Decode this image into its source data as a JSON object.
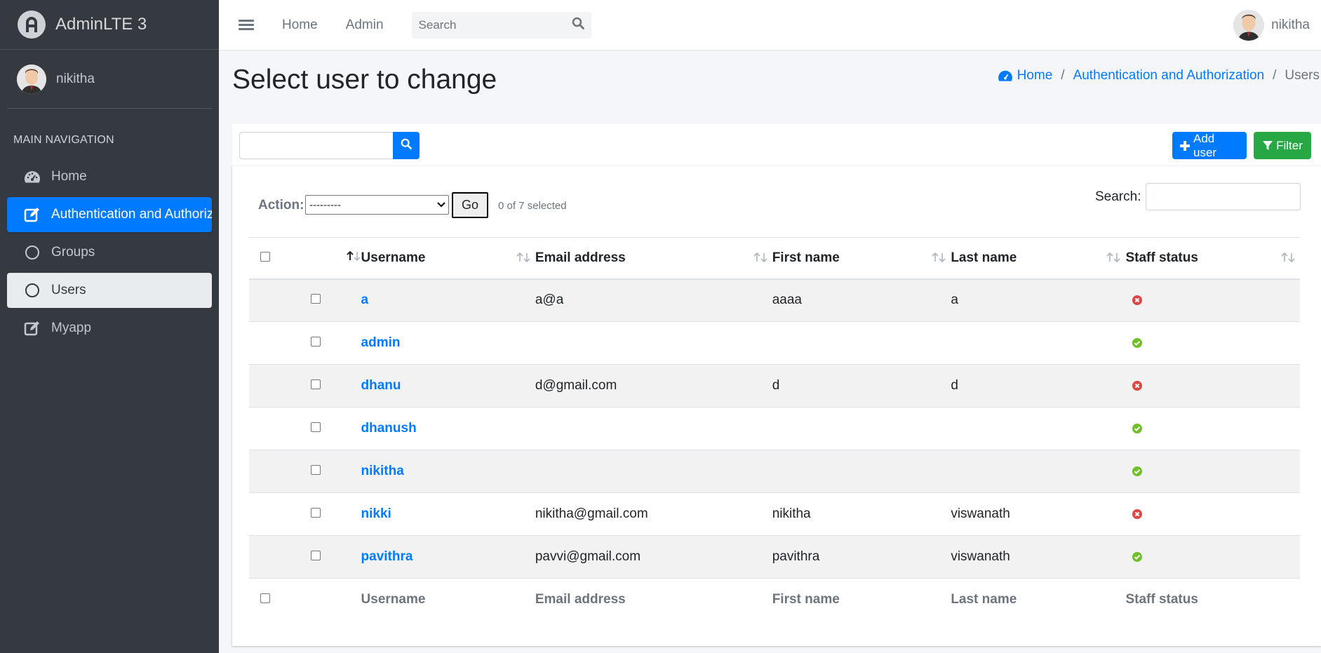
{
  "brand": {
    "name": "AdminLTE 3"
  },
  "sidebar": {
    "user": "nikitha",
    "nav_header": "MAIN NAVIGATION",
    "items": [
      {
        "label": "Home",
        "icon": "dashboard-icon"
      },
      {
        "label": "Authentication and Authorization",
        "icon": "edit-icon"
      },
      {
        "label": "Groups",
        "icon": "circle-icon"
      },
      {
        "label": "Users",
        "icon": "circle-icon"
      },
      {
        "label": "Myapp",
        "icon": "edit-icon"
      }
    ]
  },
  "navbar": {
    "links": [
      "Home",
      "Admin"
    ],
    "search_placeholder": "Search",
    "user": "nikitha"
  },
  "page": {
    "title": "Select user to change",
    "breadcrumb": [
      "Home",
      "Authentication and Authorization",
      "Users"
    ]
  },
  "toolbar": {
    "add_label": "Add user",
    "filter_label": "Filter"
  },
  "actions": {
    "label": "Action:",
    "select_value": "---------",
    "go_label": "Go",
    "selected_text": "0 of 7 selected",
    "search_label": "Search:"
  },
  "table": {
    "columns": [
      "Username",
      "Email address",
      "First name",
      "Last name",
      "Staff status"
    ],
    "rows": [
      {
        "username": "a",
        "email": "a@a",
        "first": "aaaa",
        "last": "a",
        "staff": false
      },
      {
        "username": "admin",
        "email": "",
        "first": "",
        "last": "",
        "staff": true
      },
      {
        "username": "dhanu",
        "email": "d@gmail.com",
        "first": "d",
        "last": "d",
        "staff": false
      },
      {
        "username": "dhanush",
        "email": "",
        "first": "",
        "last": "",
        "staff": true
      },
      {
        "username": "nikitha",
        "email": "",
        "first": "",
        "last": "",
        "staff": true
      },
      {
        "username": "nikki",
        "email": "nikitha@gmail.com",
        "first": "nikitha",
        "last": "viswanath",
        "staff": false
      },
      {
        "username": "pavithra",
        "email": "pavvi@gmail.com",
        "first": "pavithra",
        "last": "viswanath",
        "staff": true
      }
    ]
  },
  "colors": {
    "primary": "#007bff",
    "success": "#28a745",
    "sidebar": "#343a40",
    "status_yes": "#70bf2b",
    "status_no": "#dd4646"
  }
}
